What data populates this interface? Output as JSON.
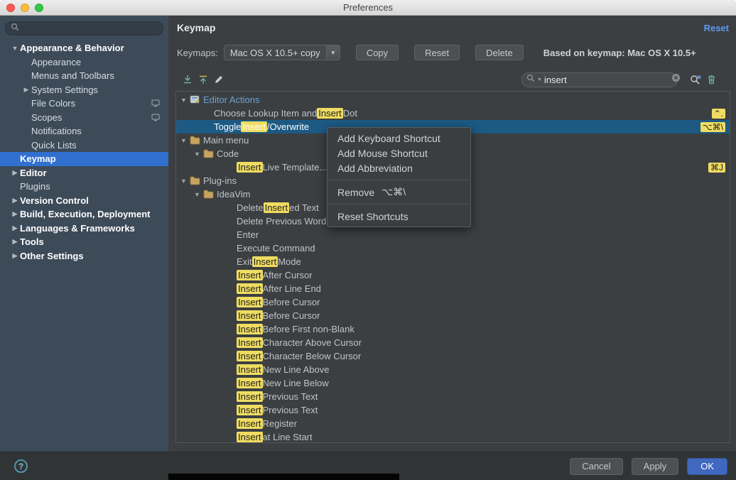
{
  "window": {
    "title": "Preferences"
  },
  "colors": {
    "sidebar_bg": "#3d4b59",
    "sidebar_selection": "#3170cf",
    "main_bg": "#3c3f41",
    "tree_selection": "#1c5a84",
    "search_highlight": "#efdc61",
    "link_blue": "#5c9bf5",
    "ok_button_blue": "#4068bf"
  },
  "sidebar": {
    "search": {
      "value": "",
      "placeholder": ""
    },
    "items": [
      {
        "label": "Appearance & Behavior",
        "bold": true,
        "arrow": "down",
        "indent": 0
      },
      {
        "label": "Appearance",
        "indent": 1
      },
      {
        "label": "Menus and Toolbars",
        "indent": 1
      },
      {
        "label": "System Settings",
        "arrow": "right",
        "indent": 1
      },
      {
        "label": "File Colors",
        "indent": 1,
        "badge": true
      },
      {
        "label": "Scopes",
        "indent": 1,
        "badge": true
      },
      {
        "label": "Notifications",
        "indent": 1
      },
      {
        "label": "Quick Lists",
        "indent": 1
      },
      {
        "label": "Keymap",
        "selected": true,
        "indent": 0
      },
      {
        "label": "Editor",
        "bold": true,
        "arrow": "right",
        "indent": 0
      },
      {
        "label": "Plugins",
        "indent": 0
      },
      {
        "label": "Version Control",
        "bold": true,
        "arrow": "right",
        "indent": 0
      },
      {
        "label": "Build, Execution, Deployment",
        "bold": true,
        "arrow": "right",
        "indent": 0
      },
      {
        "label": "Languages & Frameworks",
        "bold": true,
        "arrow": "right",
        "indent": 0
      },
      {
        "label": "Tools",
        "bold": true,
        "arrow": "right",
        "indent": 0
      },
      {
        "label": "Other Settings",
        "bold": true,
        "arrow": "right",
        "indent": 0
      }
    ]
  },
  "header": {
    "title": "Keymap",
    "reset_link": "Reset"
  },
  "keymap_bar": {
    "label": "Keymaps:",
    "selected_keymap": "Mac OS X 10.5+ copy",
    "copy_button": "Copy",
    "reset_button": "Reset",
    "delete_button": "Delete",
    "based_on": "Based on keymap: Mac OS X 10.5+"
  },
  "toolbar": {
    "search_value": "insert"
  },
  "tree": {
    "rows": [
      {
        "type": "group",
        "indent": 0,
        "arrow": "down",
        "icon": "editor-actions-icon",
        "blue": true,
        "parts": [
          {
            "t": "Editor Actions"
          }
        ]
      },
      {
        "type": "action",
        "indent": 1,
        "parts": [
          {
            "t": "Choose Lookup Item and "
          },
          {
            "t": "Insert",
            "hl": true
          },
          {
            "t": " Dot"
          }
        ],
        "shortcut": "⌃."
      },
      {
        "type": "action",
        "indent": 1,
        "selected": true,
        "parts": [
          {
            "t": "Toggle "
          },
          {
            "t": "Insert",
            "hl": true
          },
          {
            "t": "/Overwrite"
          }
        ],
        "shortcut": "⌥⌘\\"
      },
      {
        "type": "group",
        "indent": 0,
        "arrow": "down",
        "icon": "folder-icon",
        "parts": [
          {
            "t": "Main menu"
          }
        ]
      },
      {
        "type": "group",
        "indent": 1,
        "arrow": "down",
        "icon": "folder-icon",
        "parts": [
          {
            "t": "Code"
          }
        ]
      },
      {
        "type": "action",
        "indent": 2,
        "parts": [
          {
            "t": "Insert",
            "hl": true
          },
          {
            "t": " Live Template..."
          }
        ],
        "shortcut": "⌘J"
      },
      {
        "type": "group",
        "indent": 0,
        "arrow": "down",
        "icon": "folder-icon",
        "parts": [
          {
            "t": "Plug-ins"
          }
        ]
      },
      {
        "type": "group",
        "indent": 1,
        "arrow": "down",
        "icon": "folder-icon",
        "parts": [
          {
            "t": "IdeaVim"
          }
        ]
      },
      {
        "type": "action",
        "indent": 2,
        "parts": [
          {
            "t": "Delete "
          },
          {
            "t": "Insert",
            "hl": true
          },
          {
            "t": "ed Text"
          }
        ]
      },
      {
        "type": "action",
        "indent": 2,
        "parts": [
          {
            "t": "Delete Previous Word"
          }
        ]
      },
      {
        "type": "action",
        "indent": 2,
        "parts": [
          {
            "t": "Enter"
          }
        ]
      },
      {
        "type": "action",
        "indent": 2,
        "parts": [
          {
            "t": "Execute Command"
          }
        ]
      },
      {
        "type": "action",
        "indent": 2,
        "parts": [
          {
            "t": "Exit "
          },
          {
            "t": "Insert",
            "hl": true
          },
          {
            "t": " Mode"
          }
        ]
      },
      {
        "type": "action",
        "indent": 2,
        "parts": [
          {
            "t": "Insert",
            "hl": true
          },
          {
            "t": " After Cursor"
          }
        ]
      },
      {
        "type": "action",
        "indent": 2,
        "parts": [
          {
            "t": "Insert",
            "hl": true
          },
          {
            "t": " After Line End"
          }
        ]
      },
      {
        "type": "action",
        "indent": 2,
        "parts": [
          {
            "t": "Insert",
            "hl": true
          },
          {
            "t": " Before Cursor"
          }
        ]
      },
      {
        "type": "action",
        "indent": 2,
        "parts": [
          {
            "t": "Insert",
            "hl": true
          },
          {
            "t": " Before Cursor"
          }
        ]
      },
      {
        "type": "action",
        "indent": 2,
        "parts": [
          {
            "t": "Insert",
            "hl": true
          },
          {
            "t": " Before First non-Blank"
          }
        ]
      },
      {
        "type": "action",
        "indent": 2,
        "parts": [
          {
            "t": "Insert",
            "hl": true
          },
          {
            "t": " Character Above Cursor"
          }
        ]
      },
      {
        "type": "action",
        "indent": 2,
        "parts": [
          {
            "t": "Insert",
            "hl": true
          },
          {
            "t": " Character Below Cursor"
          }
        ]
      },
      {
        "type": "action",
        "indent": 2,
        "parts": [
          {
            "t": "Insert",
            "hl": true
          },
          {
            "t": " New Line Above"
          }
        ]
      },
      {
        "type": "action",
        "indent": 2,
        "parts": [
          {
            "t": "Insert",
            "hl": true
          },
          {
            "t": " New Line Below"
          }
        ]
      },
      {
        "type": "action",
        "indent": 2,
        "parts": [
          {
            "t": "Insert",
            "hl": true
          },
          {
            "t": " Previous Text"
          }
        ]
      },
      {
        "type": "action",
        "indent": 2,
        "parts": [
          {
            "t": "Insert",
            "hl": true
          },
          {
            "t": " Previous Text"
          }
        ]
      },
      {
        "type": "action",
        "indent": 2,
        "parts": [
          {
            "t": "Insert",
            "hl": true
          },
          {
            "t": " Register"
          }
        ]
      },
      {
        "type": "action",
        "indent": 2,
        "parts": [
          {
            "t": "Insert",
            "hl": true
          },
          {
            "t": " at Line Start"
          }
        ]
      }
    ]
  },
  "context_menu": {
    "items": [
      {
        "label": "Add Keyboard Shortcut"
      },
      {
        "label": "Add Mouse Shortcut"
      },
      {
        "label": "Add Abbreviation"
      },
      {
        "sep": true
      },
      {
        "label": "Remove",
        "shortcut": "⌥⌘\\"
      },
      {
        "sep": true
      },
      {
        "label": "Reset Shortcuts"
      }
    ]
  },
  "footer": {
    "cancel": "Cancel",
    "apply": "Apply",
    "ok": "OK",
    "help": "?"
  }
}
